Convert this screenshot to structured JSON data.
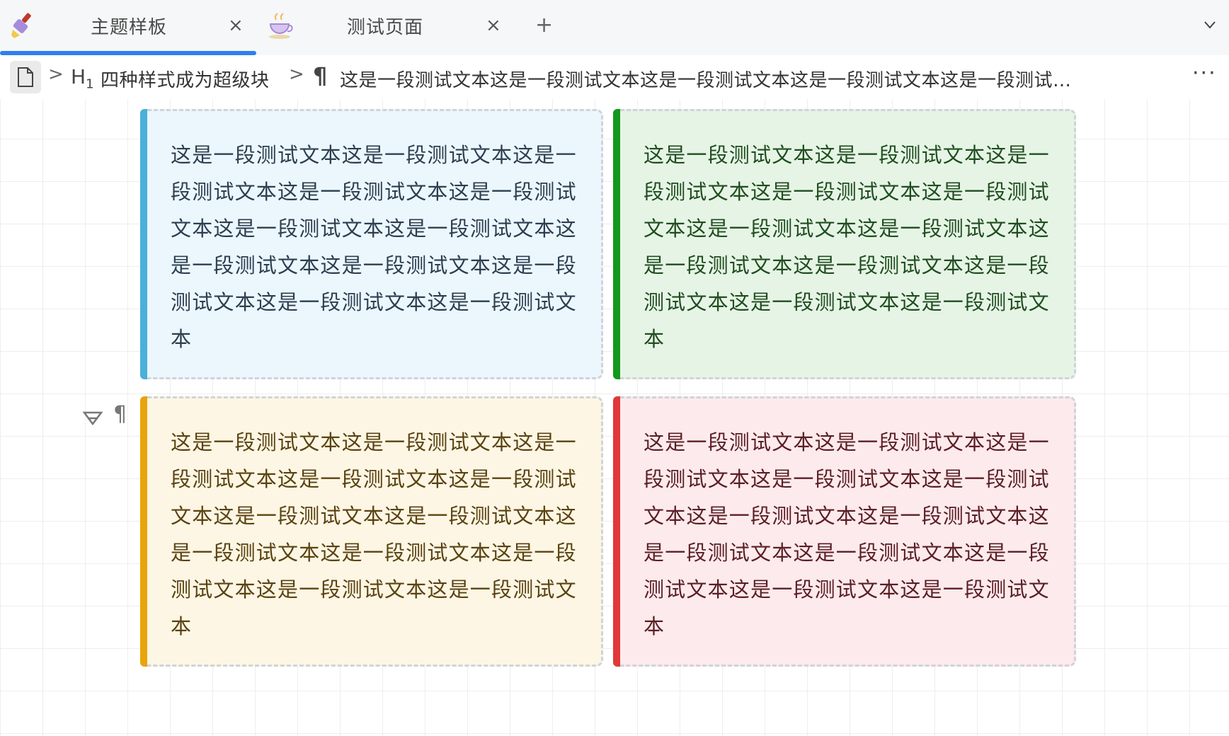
{
  "tabs": [
    {
      "title": "主题样板",
      "close": "×",
      "icon": "paintbrush-icon",
      "active": true
    },
    {
      "title": "测试页面",
      "close": "×",
      "icon": "teacup-icon",
      "active": false
    }
  ],
  "tab_add": "+",
  "breadcrumb": {
    "heading_marker": "H",
    "heading_level": "1",
    "heading_text": "四种样式成为超级块",
    "paragraph_marker": "¶",
    "paragraph_text": "这是一段测试文本这是一段测试文本这是一段测试文本这是一段测试文本这是一段测试…",
    "separator": ">",
    "more": "···"
  },
  "gutter": {
    "fold_icon": "super-block-icon",
    "paragraph_marker": "¶"
  },
  "blocks": [
    {
      "style": "info",
      "text": "这是一段测试文本这是一段测试文本这是一段测试文本这是一段测试文本这是一段测试文本这是一段测试文本这是一段测试文本这是一段测试文本这是一段测试文本这是一段测试文本这是一段测试文本这是一段测试文本"
    },
    {
      "style": "success",
      "text": "这是一段测试文本这是一段测试文本这是一段测试文本这是一段测试文本这是一段测试文本这是一段测试文本这是一段测试文本这是一段测试文本这是一段测试文本这是一段测试文本这是一段测试文本这是一段测试文本"
    },
    {
      "style": "warning",
      "text": "这是一段测试文本这是一段测试文本这是一段测试文本这是一段测试文本这是一段测试文本这是一段测试文本这是一段测试文本这是一段测试文本这是一段测试文本这是一段测试文本这是一段测试文本这是一段测试文本"
    },
    {
      "style": "error",
      "text": "这是一段测试文本这是一段测试文本这是一段测试文本这是一段测试文本这是一段测试文本这是一段测试文本这是一段测试文本这是一段测试文本这是一段测试文本这是一段测试文本这是一段测试文本这是一段测试文本"
    }
  ],
  "colors": {
    "active_tab_indicator": "#2f80ed",
    "info_accent": "#4ab0d9",
    "success_accent": "#12981a",
    "warning_accent": "#e8a40c",
    "error_accent": "#e03838"
  }
}
